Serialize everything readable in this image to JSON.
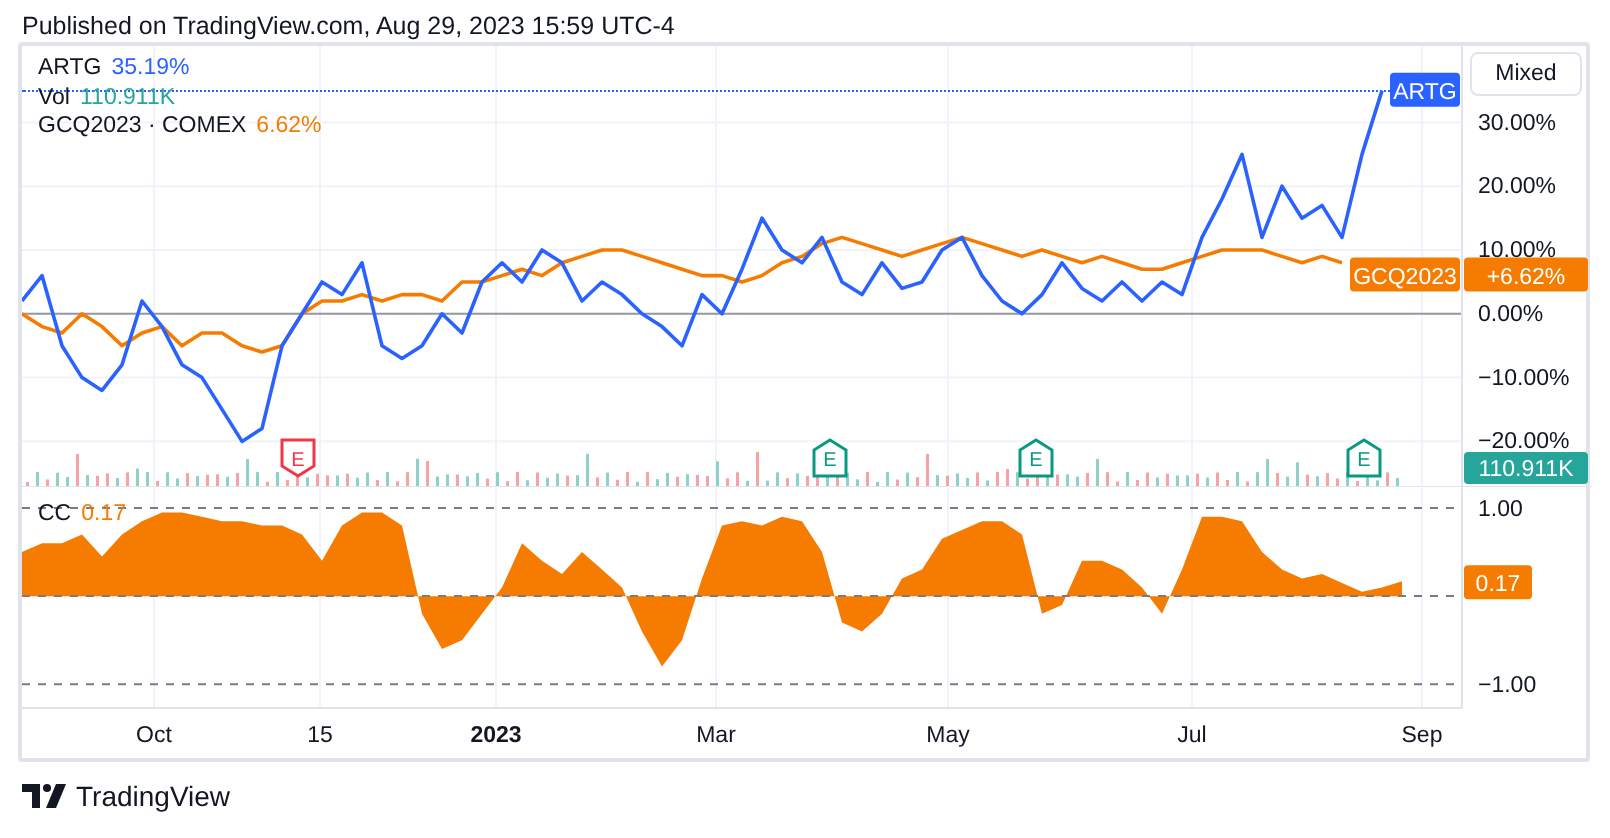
{
  "header": {
    "text": "Published on TradingView.com, Aug 29, 2023 15:59 UTC-4"
  },
  "legend": [
    {
      "symbol": "ARTG",
      "value": "35.19%",
      "color": "#2962ff"
    },
    {
      "symbol": "Vol",
      "value": "110.911K",
      "color": "#26a69a"
    },
    {
      "symbol": "GCQ2023 · COMEX",
      "value": "6.62%",
      "color": "#f57c00"
    }
  ],
  "scale_button": {
    "label": "Mixed"
  },
  "volume_tag": {
    "text": "110.911K"
  },
  "earnings": [
    {
      "label": "E",
      "kind": "down",
      "color": "#f23645"
    },
    {
      "label": "E",
      "kind": "up",
      "color": "#089981"
    },
    {
      "label": "E",
      "kind": "up",
      "color": "#089981"
    },
    {
      "label": "E",
      "kind": "up",
      "color": "#089981"
    }
  ],
  "main_chart": {
    "chart_data": {
      "type": "line",
      "ylim": [
        -27,
        42
      ],
      "grid": true,
      "yticks": [
        {
          "value": 30,
          "label": "30.00%"
        },
        {
          "value": 20,
          "label": "20.00%"
        },
        {
          "value": 10,
          "label": "10.00%"
        },
        {
          "value": 0,
          "label": "0.00%"
        },
        {
          "value": -10,
          "label": "−10.00%"
        },
        {
          "value": -20,
          "label": "−20.00%"
        }
      ],
      "series": [
        {
          "name": "ARTG",
          "color": "#2962ff",
          "values": [
            2,
            6,
            -5,
            -10,
            -12,
            -8,
            2,
            -2,
            -8,
            -10,
            -15,
            -20,
            -18,
            -5,
            0,
            5,
            3,
            8,
            -5,
            -7,
            -5,
            0,
            -3,
            5,
            8,
            5,
            10,
            8,
            2,
            5,
            3,
            0,
            -2,
            -5,
            3,
            0,
            7,
            15,
            10,
            8,
            12,
            5,
            3,
            8,
            4,
            5,
            10,
            12,
            6,
            2,
            0,
            3,
            8,
            4,
            2,
            5,
            2,
            5,
            3,
            12,
            18,
            25,
            12,
            20,
            15,
            17,
            12,
            25,
            35,
            null
          ]
        },
        {
          "name": "GCQ2023",
          "color": "#f57c00",
          "values": [
            0,
            -2,
            -3,
            0,
            -2,
            -5,
            -3,
            -2,
            -5,
            -3,
            -3,
            -5,
            -6,
            -5,
            0,
            2,
            2,
            3,
            2,
            3,
            3,
            2,
            5,
            5,
            6,
            7,
            6,
            8,
            9,
            10,
            10,
            9,
            8,
            7,
            6,
            6,
            5,
            6,
            8,
            9,
            11,
            12,
            11,
            10,
            9,
            10,
            11,
            12,
            11,
            10,
            9,
            10,
            9,
            8,
            9,
            8,
            7,
            7,
            8,
            9,
            10,
            10,
            10,
            9,
            8,
            9,
            8,
            null,
            null,
            null
          ]
        }
      ]
    },
    "price_tag": {
      "text": "+6.62%"
    }
  },
  "cc_chart": {
    "chart_data": {
      "type": "area",
      "ylim": [
        -1.27,
        1.25
      ],
      "grid": true,
      "yticks": [
        {
          "value": 1,
          "label": "1.00"
        },
        {
          "value": -1,
          "label": "−1.00"
        }
      ],
      "series": [
        {
          "name": "CC",
          "color": "#f57c00",
          "values": [
            0.5,
            0.6,
            0.6,
            0.7,
            0.45,
            0.7,
            0.85,
            0.95,
            0.95,
            0.9,
            0.85,
            0.85,
            0.8,
            0.8,
            0.7,
            0.4,
            0.8,
            0.95,
            0.95,
            0.8,
            -0.2,
            -0.6,
            -0.5,
            -0.2,
            0.1,
            0.6,
            0.4,
            0.25,
            0.5,
            0.3,
            0.1,
            -0.4,
            -0.8,
            -0.5,
            0.2,
            0.8,
            0.85,
            0.8,
            0.9,
            0.85,
            0.5,
            -0.3,
            -0.4,
            -0.2,
            0.2,
            0.3,
            0.65,
            0.75,
            0.85,
            0.85,
            0.7,
            -0.2,
            -0.1,
            0.4,
            0.4,
            0.3,
            0.1,
            -0.2,
            0.3,
            0.9,
            0.9,
            0.85,
            0.5,
            0.3,
            0.2,
            0.25,
            0.15,
            0.05,
            0.1,
            0.17
          ]
        }
      ]
    },
    "legend_value": "0.17",
    "axis_tag": "0.17"
  },
  "time_axis": [
    {
      "label": "Oct",
      "kind": "month"
    },
    {
      "label": "15",
      "kind": "day"
    },
    {
      "label": "2023",
      "kind": "year"
    },
    {
      "label": "Mar",
      "kind": "month"
    },
    {
      "label": "May",
      "kind": "month"
    },
    {
      "label": "Jul",
      "kind": "month"
    },
    {
      "label": "Sep",
      "kind": "month"
    }
  ],
  "footer": {
    "brand": "TradingView"
  }
}
